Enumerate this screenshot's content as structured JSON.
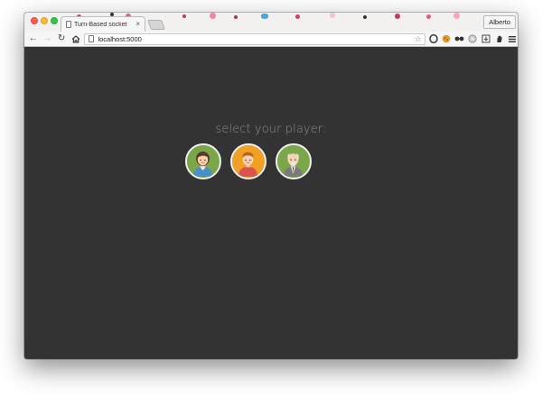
{
  "browser": {
    "tab_title": "Turn-Based socket",
    "profile_name": "Alberto",
    "url": "localhost:5000"
  },
  "page": {
    "heading": "select your player:",
    "background": "#333333",
    "players": [
      {
        "id": "woman",
        "ring_color": "#7ca64a",
        "icon": "woman-avatar-icon"
      },
      {
        "id": "boy",
        "ring_color": "#f0a024",
        "icon": "boy-avatar-icon"
      },
      {
        "id": "old-man",
        "ring_color": "#7ca64a",
        "icon": "old-man-avatar-icon"
      }
    ]
  }
}
